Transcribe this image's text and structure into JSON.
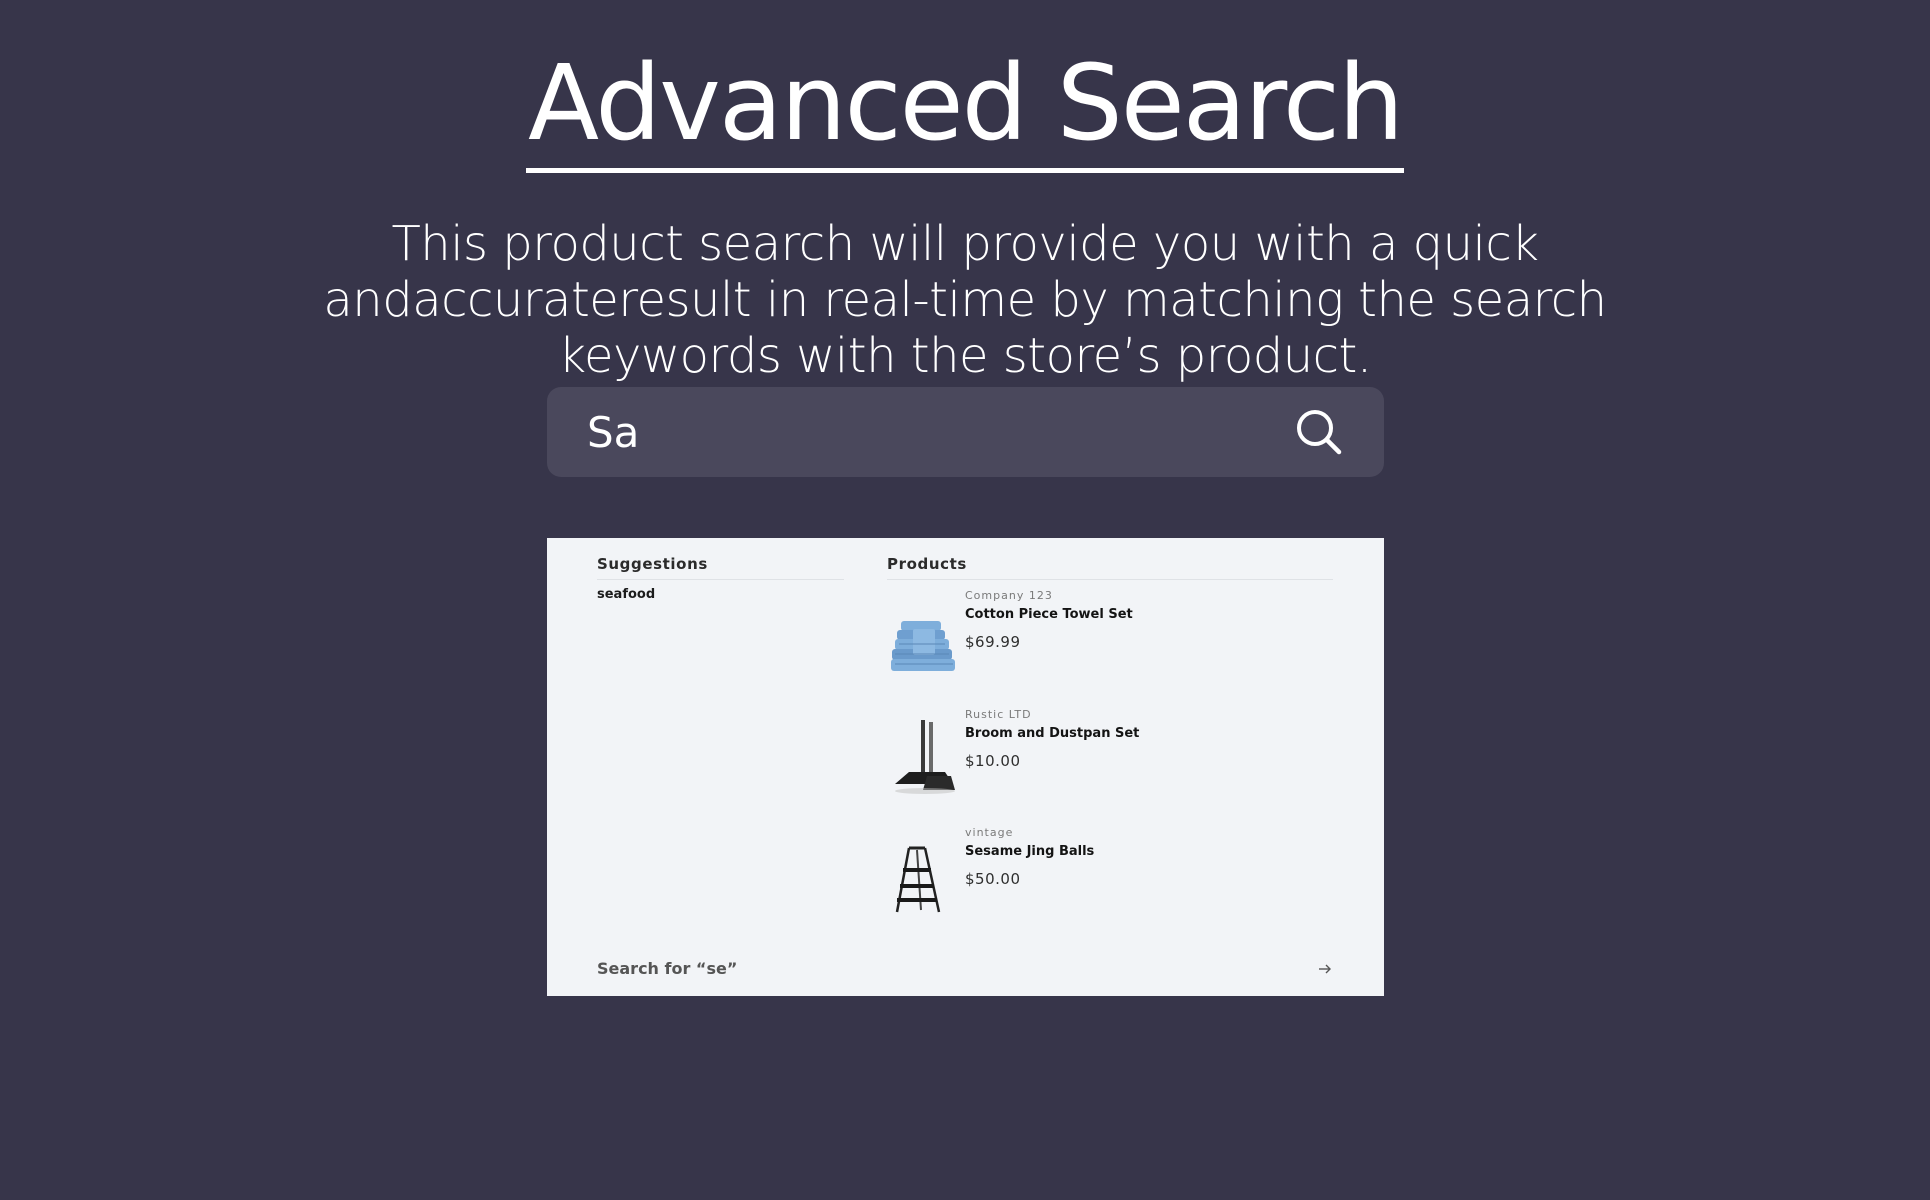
{
  "hero": {
    "title": "Advanced Search",
    "subtitle": "This product search will provide you with a quick andaccurateresult in real-time by matching the search keywords with the store’s product."
  },
  "search": {
    "value": "Sa",
    "icon": "search-icon"
  },
  "dropdown": {
    "suggestions_heading": "Suggestions",
    "suggestions": [
      "seafood"
    ],
    "products_heading": "Products",
    "products": [
      {
        "vendor": "Company 123",
        "title": "Cotton Piece Towel Set",
        "price": "$69.99",
        "thumb": "towel-stack"
      },
      {
        "vendor": "Rustic LTD",
        "title": "Broom and Dustpan Set",
        "price": "$10.00",
        "thumb": "broom-dustpan"
      },
      {
        "vendor": "vintage",
        "title": "Sesame Jing Balls",
        "price": "$50.00",
        "thumb": "step-ladder"
      }
    ],
    "search_for": "Search for “se”",
    "arrow_icon": "arrow-right-icon"
  },
  "colors": {
    "background": "#37354a",
    "search_bar": "#4a485c",
    "dropdown": "#f2f4f7",
    "towel_blue": "#6f9fd0"
  }
}
